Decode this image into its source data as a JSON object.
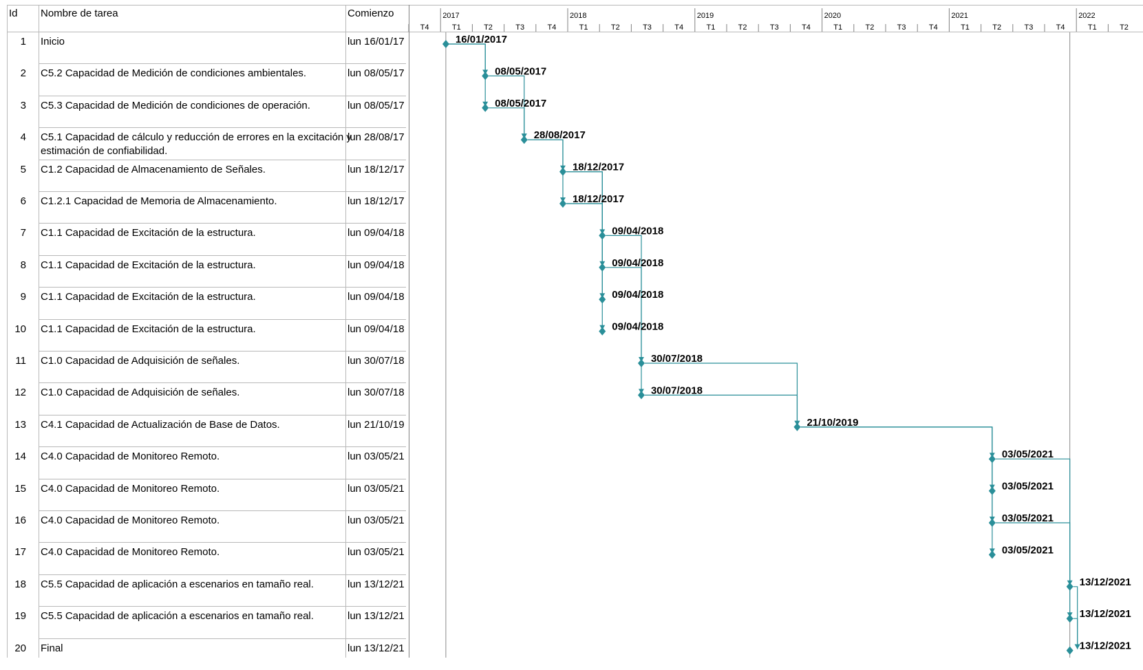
{
  "table": {
    "headers": {
      "id": "Id",
      "name": "Nombre de tarea",
      "start": "Comienzo"
    },
    "rows": [
      {
        "id": "1",
        "name": "Inicio",
        "start": "lun 16/01/17",
        "label": "16/01/2017",
        "kind": "milestone-start"
      },
      {
        "id": "2",
        "name": "C5.2 Capacidad de Medición de condiciones ambientales.",
        "start": "lun 08/05/17",
        "label": "08/05/2017"
      },
      {
        "id": "3",
        "name": "C5.3 Capacidad de Medición de condiciones de operación.",
        "start": "lun 08/05/17",
        "label": "08/05/2017"
      },
      {
        "id": "4",
        "name": "C5.1 Capacidad de cálculo y reducción de errores en la excitación y",
        "name2": "estimación de confiabilidad.",
        "start": "lun 28/08/17",
        "label": "28/08/2017"
      },
      {
        "id": "5",
        "name": "C1.2 Capacidad de Almacenamiento de Señales.",
        "start": "lun 18/12/17",
        "label": "18/12/2017"
      },
      {
        "id": "6",
        "name": "C1.2.1 Capacidad de Memoria de Almacenamiento.",
        "start": "lun 18/12/17",
        "label": "18/12/2017"
      },
      {
        "id": "7",
        "name": "C1.1 Capacidad de Excitación de la estructura.",
        "start": "lun 09/04/18",
        "label": "09/04/2018"
      },
      {
        "id": "8",
        "name": "C1.1 Capacidad de Excitación de la estructura.",
        "start": "lun 09/04/18",
        "label": "09/04/2018"
      },
      {
        "id": "9",
        "name": "C1.1 Capacidad de Excitación de la estructura.",
        "start": "lun 09/04/18",
        "label": "09/04/2018"
      },
      {
        "id": "10",
        "name": "C1.1 Capacidad de Excitación de la estructura.",
        "start": "lun 09/04/18",
        "label": "09/04/2018"
      },
      {
        "id": "11",
        "name": "C1.0 Capacidad de Adquisición de señales.",
        "start": "lun 30/07/18",
        "label": "30/07/2018"
      },
      {
        "id": "12",
        "name": "C1.0 Capacidad de Adquisición de señales.",
        "start": "lun 30/07/18",
        "label": "30/07/2018"
      },
      {
        "id": "13",
        "name": "C4.1 Capacidad de Actualización de Base de Datos.",
        "start": "lun 21/10/19",
        "label": "21/10/2019"
      },
      {
        "id": "14",
        "name": "C4.0 Capacidad de Monitoreo Remoto.",
        "start": "lun 03/05/21",
        "label": "03/05/2021"
      },
      {
        "id": "15",
        "name": "C4.0 Capacidad de Monitoreo Remoto.",
        "start": "lun 03/05/21",
        "label": "03/05/2021"
      },
      {
        "id": "16",
        "name": "C4.0 Capacidad de Monitoreo Remoto.",
        "start": "lun 03/05/21",
        "label": "03/05/2021"
      },
      {
        "id": "17",
        "name": "C4.0 Capacidad de Monitoreo Remoto.",
        "start": "lun 03/05/21",
        "label": "03/05/2021"
      },
      {
        "id": "18",
        "name": "C5.5 Capacidad de aplicación a escenarios en tamaño real.",
        "start": "lun 13/12/21",
        "label": "13/12/2021"
      },
      {
        "id": "19",
        "name": "C5.5 Capacidad de aplicación a escenarios en tamaño real.",
        "start": "lun 13/12/21",
        "label": "13/12/2021"
      },
      {
        "id": "20",
        "name": "Final",
        "start": "lun 13/12/21",
        "label": "13/12/2021",
        "kind": "milestone-end"
      }
    ]
  },
  "timescale": {
    "years": [
      "2017",
      "2018",
      "2019",
      "2020",
      "2021",
      "2022"
    ],
    "quarters": [
      "T4",
      "T1",
      "T2",
      "T3",
      "T4",
      "T1",
      "T2",
      "T3",
      "T4",
      "T1",
      "T2",
      "T3",
      "T4",
      "T1",
      "T2",
      "T3",
      "T4",
      "T1",
      "T2",
      "T3",
      "T4",
      "T1",
      "T2"
    ]
  },
  "colors": {
    "milestone": "#2a8f99",
    "link": "#2a8f99",
    "grid": "#b8b8b8"
  }
}
